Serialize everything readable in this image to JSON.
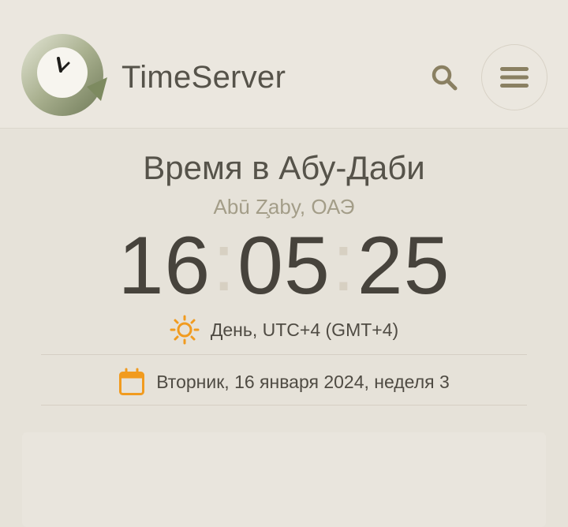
{
  "header": {
    "site_name": "TimeServer",
    "logo_icon": "clock-refresh-logo",
    "search_icon": "search-icon",
    "menu_icon": "hamburger-menu-icon"
  },
  "location": {
    "title": "Время в Абу-Даби",
    "native_name": "Abū Z̧aby, ОАЭ"
  },
  "clock": {
    "hours": "16",
    "minutes": "05",
    "seconds": "25"
  },
  "daylight": {
    "icon": "sun-icon",
    "text": "День, UTC+4 (GMT+4)"
  },
  "date": {
    "icon": "calendar-icon",
    "text": "Вторник, 16 января 2024, неделя 3"
  },
  "colors": {
    "background": "#e6e2d9",
    "accent_orange": "#f19b1f",
    "text_dark": "#47433c",
    "text_muted": "#a39d88"
  }
}
